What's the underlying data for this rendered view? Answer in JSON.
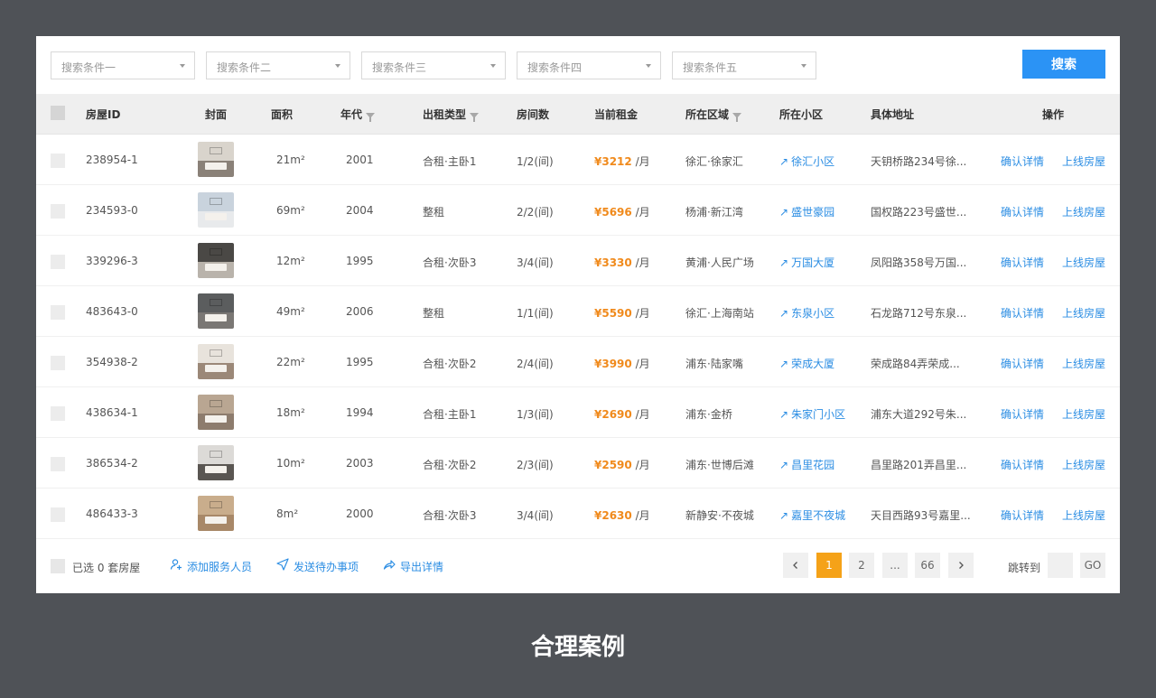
{
  "filters": [
    {
      "placeholder": "搜索条件一"
    },
    {
      "placeholder": "搜索条件二"
    },
    {
      "placeholder": "搜索条件三"
    },
    {
      "placeholder": "搜索条件四"
    },
    {
      "placeholder": "搜索条件五"
    }
  ],
  "search_label": "搜索",
  "columns": {
    "id": "房屋ID",
    "cover": "封面",
    "area": "面积",
    "year": "年代",
    "type": "出租类型",
    "rooms": "房间数",
    "rent": "当前租金",
    "district": "所在区域",
    "community": "所在小区",
    "address": "具体地址",
    "actions": "操作"
  },
  "rows": [
    {
      "id": "238954-1",
      "area": "21m²",
      "year": "2001",
      "type": "合租·主卧1",
      "rooms": "1/2(间)",
      "rent": "¥3212",
      "unit": "/月",
      "district": "徐汇·徐家汇",
      "community": "徐汇小区",
      "address": "天钥桥路234号徐...",
      "confirm": "确认详情",
      "online": "上线房屋",
      "cover_wall": "#d9d4cc",
      "cover_floor": "#8a8178"
    },
    {
      "id": "234593-0",
      "area": "69m²",
      "year": "2004",
      "type": "整租",
      "rooms": "2/2(间)",
      "rent": "¥5696",
      "unit": "/月",
      "district": "杨浦·新江湾",
      "community": "盛世豪园",
      "address": "国权路223号盛世...",
      "confirm": "确认详情",
      "online": "上线房屋",
      "cover_wall": "#c9d3dd",
      "cover_floor": "#e8eaec"
    },
    {
      "id": "339296-3",
      "area": "12m²",
      "year": "1995",
      "type": "合租·次卧3",
      "rooms": "3/4(间)",
      "rent": "¥3330",
      "unit": "/月",
      "district": "黄浦·人民广场",
      "community": "万国大厦",
      "address": "凤阳路358号万国...",
      "confirm": "确认详情",
      "online": "上线房屋",
      "cover_wall": "#4a4845",
      "cover_floor": "#b9b3ab"
    },
    {
      "id": "483643-0",
      "area": "49m²",
      "year": "2006",
      "type": "整租",
      "rooms": "1/1(间)",
      "rent": "¥5590",
      "unit": "/月",
      "district": "徐汇·上海南站",
      "community": "东泉小区",
      "address": "石龙路712号东泉...",
      "confirm": "确认详情",
      "online": "上线房屋",
      "cover_wall": "#5b5d5e",
      "cover_floor": "#7a7774"
    },
    {
      "id": "354938-2",
      "area": "22m²",
      "year": "1995",
      "type": "合租·次卧2",
      "rooms": "2/4(间)",
      "rent": "¥3990",
      "unit": "/月",
      "district": "浦东·陆家嘴",
      "community": "荣成大厦",
      "address": "荣成路84弄荣成...",
      "confirm": "确认详情",
      "online": "上线房屋",
      "cover_wall": "#e8e3dc",
      "cover_floor": "#9b8878"
    },
    {
      "id": "438634-1",
      "area": "18m²",
      "year": "1994",
      "type": "合租·主卧1",
      "rooms": "1/3(间)",
      "rent": "¥2690",
      "unit": "/月",
      "district": "浦东·金桥",
      "community": "朱家门小区",
      "address": "浦东大道292号朱...",
      "confirm": "确认详情",
      "online": "上线房屋",
      "cover_wall": "#b9a692",
      "cover_floor": "#8d7c6d"
    },
    {
      "id": "386534-2",
      "area": "10m²",
      "year": "2003",
      "type": "合租·次卧2",
      "rooms": "2/3(间)",
      "rent": "¥2590",
      "unit": "/月",
      "district": "浦东·世博后滩",
      "community": "昌里花园",
      "address": "昌里路201弄昌里...",
      "confirm": "确认详情",
      "online": "上线房屋",
      "cover_wall": "#dcdad7",
      "cover_floor": "#5a5652"
    },
    {
      "id": "486433-3",
      "area": "8m²",
      "year": "2000",
      "type": "合租·次卧3",
      "rooms": "3/4(间)",
      "rent": "¥2630",
      "unit": "/月",
      "district": "新静安·不夜城",
      "community": "嘉里不夜城",
      "address": "天目西路93号嘉里...",
      "confirm": "确认详情",
      "online": "上线房屋",
      "cover_wall": "#c9ad8c",
      "cover_floor": "#a88868"
    }
  ],
  "footer": {
    "selected": "已选 0 套房屋",
    "add_staff": "添加服务人员",
    "send_todo": "发送待办事项",
    "export": "导出详情",
    "pages": [
      "1",
      "2",
      "...",
      "66"
    ],
    "jump_label": "跳转到",
    "go_label": "GO"
  },
  "caption": "合理案例"
}
